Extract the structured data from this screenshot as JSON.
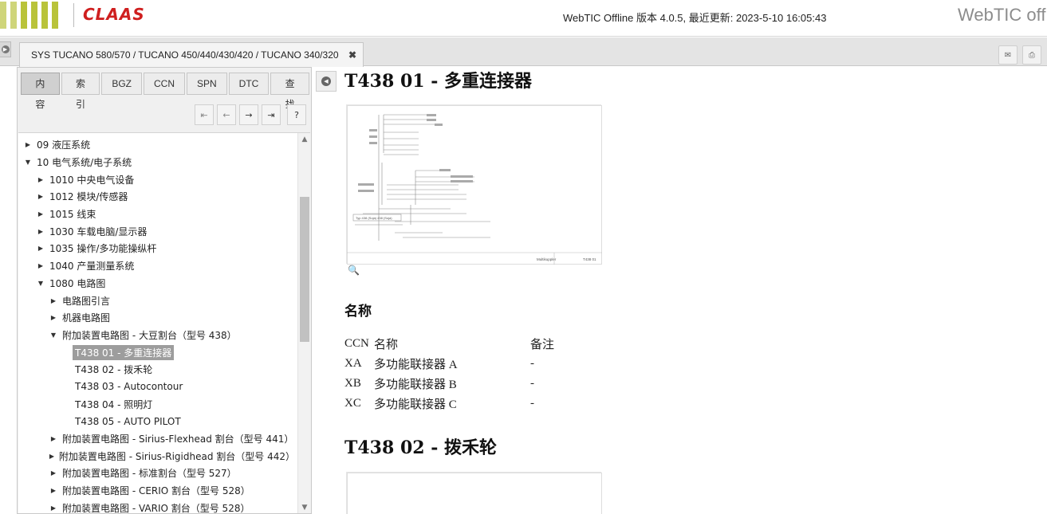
{
  "header": {
    "logo_text": "CLAAS",
    "version_text": "WebTIC Offline 版本 4.0.5, 最近更新:  2023-5-10 16:05:43",
    "brand_text": "WebTIC offline"
  },
  "tabbar": {
    "doc_tab_label": "SYS TUCANO 580/570 / TUCANO 450/440/430/420 / TUCANO 340/320",
    "close_glyph": "✖",
    "tools": [
      {
        "name": "email-icon",
        "glyph": "✉"
      },
      {
        "name": "print-icon",
        "glyph": "⎙"
      }
    ]
  },
  "sidebar": {
    "tabs": [
      {
        "label": "内容",
        "active": true
      },
      {
        "label": "索引"
      },
      {
        "label": "BGZ"
      },
      {
        "label": "CCN"
      },
      {
        "label": "SPN"
      },
      {
        "label": "DTC"
      },
      {
        "label": "查找"
      }
    ],
    "nav": [
      {
        "name": "first-arrow-icon",
        "glyph": "⇤"
      },
      {
        "name": "prev-arrow-icon",
        "glyph": "←"
      },
      {
        "name": "next-arrow-icon",
        "glyph": "→"
      },
      {
        "name": "last-arrow-icon",
        "glyph": "⇥"
      },
      {
        "name": "help-icon",
        "glyph": "?"
      }
    ],
    "tree": [
      {
        "label": "09 液压系统",
        "level": 0,
        "state": "collapsed"
      },
      {
        "label": "10 电气系统/电子系统",
        "level": 0,
        "state": "expanded"
      },
      {
        "label": "1010 中央电气设备",
        "level": 1,
        "state": "collapsed"
      },
      {
        "label": "1012 模块/传感器",
        "level": 1,
        "state": "collapsed"
      },
      {
        "label": "1015 线束",
        "level": 1,
        "state": "collapsed"
      },
      {
        "label": "1030 车载电脑/显示器",
        "level": 1,
        "state": "collapsed"
      },
      {
        "label": "1035 操作/多功能操纵杆",
        "level": 1,
        "state": "collapsed"
      },
      {
        "label": "1040 产量测量系统",
        "level": 1,
        "state": "collapsed"
      },
      {
        "label": "1080 电路图",
        "level": 1,
        "state": "expanded"
      },
      {
        "label": "电路图引言",
        "level": 2,
        "state": "collapsed"
      },
      {
        "label": "机器电路图",
        "level": 2,
        "state": "collapsed"
      },
      {
        "label": "附加装置电路图 - 大豆割台（型号 438）",
        "level": 2,
        "state": "expanded"
      },
      {
        "label": "T438 01 - 多重连接器",
        "level": 3,
        "state": "leaf",
        "selected": true
      },
      {
        "label": "T438 02 - 拨禾轮",
        "level": 3,
        "state": "leaf"
      },
      {
        "label": "T438 03 - Autocontour",
        "level": 3,
        "state": "leaf"
      },
      {
        "label": "T438 04 - 照明灯",
        "level": 3,
        "state": "leaf"
      },
      {
        "label": "T438 05 - AUTO PILOT",
        "level": 3,
        "state": "leaf"
      },
      {
        "label": "附加装置电路图 - Sirius-Flexhead 割台（型号 441）",
        "level": 2,
        "state": "collapsed"
      },
      {
        "label": "附加装置电路图 - Sirius-Rigidhead 割台（型号 442）",
        "level": 2,
        "state": "collapsed"
      },
      {
        "label": "附加装置电路图 - 标准割台（型号 527）",
        "level": 2,
        "state": "collapsed"
      },
      {
        "label": "附加装置电路图 - CERIO 割台（型号 528）",
        "level": 2,
        "state": "collapsed"
      },
      {
        "label": "附加装置电路图 - VARIO 割台（型号 528）",
        "level": 2,
        "state": "collapsed"
      }
    ]
  },
  "content": {
    "section1_title": "T438 01 - 多重连接器",
    "diagram1": {
      "inner_label": "Typ 438 (Soja) 438 (Soja)",
      "footer_mid": "Multikuppler",
      "footer_right": "T438 01"
    },
    "names_heading": "名称",
    "table": {
      "headers": [
        "CCN",
        "名称",
        "备注"
      ],
      "rows": [
        [
          "XA",
          "多功能联接器 A",
          "-"
        ],
        [
          "XB",
          "多功能联接器 B",
          "-"
        ],
        [
          "XC",
          "多功能联接器 C",
          "-"
        ]
      ]
    },
    "section2_title": "T438 02 - 拨禾轮",
    "zoom_glyph": "🔍"
  }
}
